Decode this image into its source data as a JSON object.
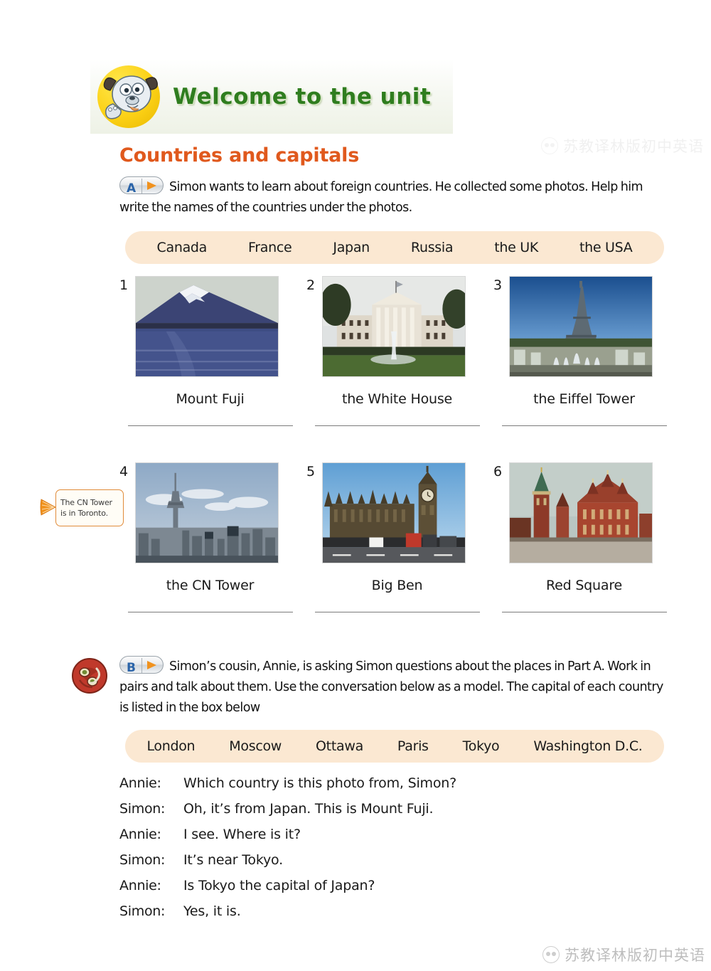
{
  "header": {
    "title": "Welcome to the unit",
    "mascot_icon": "cartoon-dog-icon"
  },
  "section": {
    "heading": "Countries and capitals"
  },
  "task_a": {
    "badge_letter": "A",
    "badge_arrow_icon": "play-arrow-icon",
    "instruction_line_1": "Simon wants to learn about foreign countries. He collected some photos.",
    "instruction_line_2": "Help him write the names of the countries under the photos."
  },
  "word_bank_countries": {
    "words": [
      "Canada",
      "France",
      "Japan",
      "Russia",
      "the UK",
      "the USA"
    ]
  },
  "photos": [
    {
      "number": "1",
      "caption": "Mount Fuji",
      "image_name": "mount-fuji-photo"
    },
    {
      "number": "2",
      "caption": "the White House",
      "image_name": "white-house-photo"
    },
    {
      "number": "3",
      "caption": "the Eiffel Tower",
      "image_name": "eiffel-tower-photo"
    },
    {
      "number": "4",
      "caption": "the CN  Tower",
      "image_name": "cn-tower-photo"
    },
    {
      "number": "5",
      "caption": "Big Ben",
      "image_name": "big-ben-photo"
    },
    {
      "number": "6",
      "caption": "Red Square",
      "image_name": "red-square-photo"
    }
  ],
  "tip": {
    "line_1": "The CN Tower",
    "line_2": "is in Toronto."
  },
  "task_b": {
    "badge_letter": "B",
    "badge_arrow_icon": "play-arrow-icon",
    "icon_name": "part-b-ornament-icon",
    "instruction_line_1": "Simon’s cousin, Annie, is asking Simon questions about the places in Part A.",
    "instruction_line_2": "Work in pairs and talk about them. Use the conversation below as a model. The",
    "instruction_line_3": "capital of each country is listed in the box below"
  },
  "word_bank_capitals": {
    "words": [
      "London",
      "Moscow",
      "Ottawa",
      "Paris",
      "Tokyo",
      "Washington D.C."
    ]
  },
  "dialogue": [
    {
      "speaker": "Annie:",
      "line": "Which  country is this photo from, Simon?"
    },
    {
      "speaker": "Simon:",
      "line": "Oh, it’s from Japan. This is Mount  Fuji."
    },
    {
      "speaker": "Annie:",
      "line": "I see. Where is it?"
    },
    {
      "speaker": "Simon:",
      "line": "It’s near Tokyo."
    },
    {
      "speaker": "Annie:",
      "line": "Is Tokyo the capital of Japan?"
    },
    {
      "speaker": "Simon:",
      "line": "Yes, it is."
    }
  ],
  "watermark": {
    "text": "苏教译林版初中英语",
    "logo_icon": "wechat-logo-icon"
  },
  "colors": {
    "heading_orange": "#e0591d",
    "welcome_green": "#2f7d1f",
    "word_bank_bg": "#fbe8d2",
    "badge_letter_blue": "#2b64a8",
    "badge_arrow_orange": "#f0921e",
    "tip_border_orange": "#e08b3a",
    "answer_line_gray": "#7b7b7b"
  }
}
